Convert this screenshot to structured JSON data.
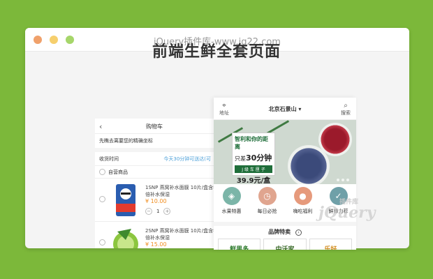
{
  "window": {
    "title": "jQuery插件库-www.jq22.com"
  },
  "headline": "前端生鲜全套页面",
  "cart": {
    "title": "购物车",
    "notice": "先瞧去离要您的精确坐标",
    "delivery_label": "收货时间",
    "delivery_value": "今天30分钟可送达(可",
    "store_label": "自营商品",
    "products": [
      {
        "name": "1SNP 燕窝补水面膜 10片/盒含华 双倍补水保湿",
        "price": "¥ 10.00",
        "qty": "1"
      },
      {
        "name": "2SNP 燕窝补水面膜 10片/盒含华 双倍补水保湿",
        "price": "¥ 15.00",
        "qty": "1"
      }
    ]
  },
  "home": {
    "location_label": "地址",
    "city": "北京石景山",
    "search_label": "搜索",
    "banner": {
      "line1": "智利和你的距离",
      "line2_prefix": "只差",
      "line2_bold": "30分钟",
      "line3": "J 级 车 厘 子",
      "price": "39.9元/盒"
    },
    "categories": [
      {
        "label": "水果特惠",
        "color": "#7bb5a8",
        "icon": "tag-icon"
      },
      {
        "label": "每日必抢",
        "color": "#e0a58f",
        "icon": "clock-icon"
      },
      {
        "label": "嗨吃福利",
        "color": "#e69a7c",
        "icon": "apple-icon"
      },
      {
        "label": "鲜蜂力荐",
        "color": "#6fa0a8",
        "icon": "thumb-icon"
      }
    ],
    "brand_title": "品牌特卖",
    "brands": [
      "鲜果多",
      "中沃家",
      "乐好"
    ]
  },
  "watermark": {
    "text": "jQuery",
    "small": "插件库"
  }
}
